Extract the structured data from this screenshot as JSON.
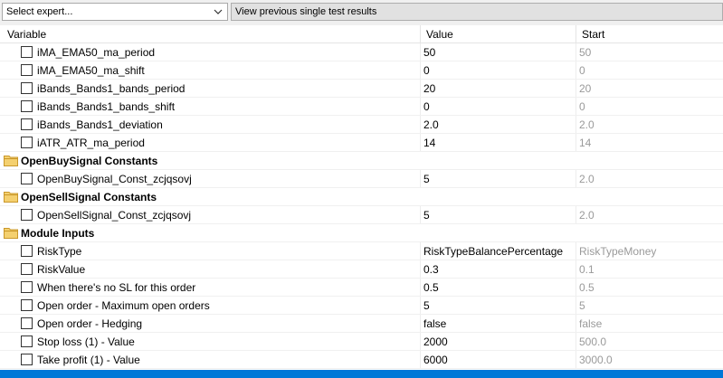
{
  "toolbar": {
    "expert_select_value": "Select expert...",
    "view_results_label": "View previous single test results"
  },
  "columns": {
    "variable": "Variable",
    "value": "Value",
    "start": "Start"
  },
  "rows": [
    {
      "kind": "param",
      "name": "iMA_EMA50_ma_period",
      "value": "50",
      "start": "50"
    },
    {
      "kind": "param",
      "name": "iMA_EMA50_ma_shift",
      "value": "0",
      "start": "0"
    },
    {
      "kind": "param",
      "name": "iBands_Bands1_bands_period",
      "value": "20",
      "start": "20"
    },
    {
      "kind": "param",
      "name": "iBands_Bands1_bands_shift",
      "value": "0",
      "start": "0"
    },
    {
      "kind": "param",
      "name": "iBands_Bands1_deviation",
      "value": "2.0",
      "start": "2.0"
    },
    {
      "kind": "param",
      "name": "iATR_ATR_ma_period",
      "value": "14",
      "start": "14"
    },
    {
      "kind": "group",
      "name": "OpenBuySignal Constants"
    },
    {
      "kind": "param",
      "name": "OpenBuySignal_Const_zcjqsovj",
      "value": "5",
      "start": "2.0"
    },
    {
      "kind": "group",
      "name": "OpenSellSignal Constants"
    },
    {
      "kind": "param",
      "name": "OpenSellSignal_Const_zcjqsovj",
      "value": "5",
      "start": "2.0"
    },
    {
      "kind": "group",
      "name": "Module Inputs"
    },
    {
      "kind": "param",
      "name": "RiskType",
      "value": "RiskTypeBalancePercentage",
      "start": "RiskTypeMoney"
    },
    {
      "kind": "param",
      "name": "RiskValue",
      "value": "0.3",
      "start": "0.1"
    },
    {
      "kind": "param",
      "name": "When there's no SL for this order",
      "value": "0.5",
      "start": "0.5"
    },
    {
      "kind": "param",
      "name": "Open order - Maximum open orders",
      "value": "5",
      "start": "5"
    },
    {
      "kind": "param",
      "name": "Open order - Hedging",
      "value": "false",
      "start": "false"
    },
    {
      "kind": "param",
      "name": "Stop loss (1) - Value",
      "value": "2000",
      "start": "500.0"
    },
    {
      "kind": "param",
      "name": "Take profit (1) - Value",
      "value": "6000",
      "start": "3000.0"
    }
  ],
  "icons": {
    "dropdown": "chevron-down-icon",
    "folder": "folder-icon",
    "checkbox": "checkbox-unchecked"
  },
  "colors": {
    "accent": "#0078d7",
    "folder": "#e8b84a",
    "start_text": "#9a9a9a"
  }
}
